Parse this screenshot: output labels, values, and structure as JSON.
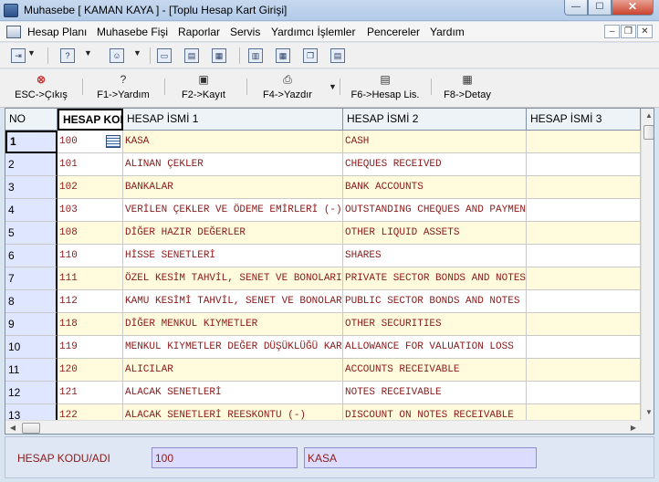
{
  "window": {
    "title": "Muhasebe [ KAMAN KAYA ]  - [Toplu Hesap Kart Girişi]",
    "min_icon": "minimize-icon",
    "max_icon": "maximize-icon",
    "close_icon": "close-icon",
    "min_glyph": "—",
    "max_glyph": "☐",
    "close_glyph": "✕"
  },
  "menu": {
    "items": [
      "Hesap Planı",
      "Muhasebe Fişi",
      "Raporlar",
      "Servis",
      "Yardımcı İşlemler",
      "Pencereler",
      "Yardım"
    ],
    "mdi_min": "–",
    "mdi_restore": "❐",
    "mdi_close": "✕"
  },
  "toolbar_small": {
    "icons": [
      "exit-icon",
      "help-icon",
      "user-icon",
      "window-icon",
      "window-list-icon",
      "table-icon",
      "grid-icon",
      "stack-icon",
      "list-icon"
    ]
  },
  "toolbar": {
    "buttons": [
      {
        "label": "ESC->Çıkış",
        "icon": "cancel-icon",
        "glyph": "⊗"
      },
      {
        "label": "F1->Yardım",
        "icon": "help-icon",
        "glyph": "?"
      },
      {
        "label": "F2->Kayıt",
        "icon": "save-icon",
        "glyph": "▣"
      },
      {
        "label": "F4->Yazdır",
        "icon": "print-icon",
        "glyph": "⎙"
      },
      {
        "label": "F6->Hesap Lis.",
        "icon": "list-icon",
        "glyph": "▤"
      },
      {
        "label": "F8->Detay",
        "icon": "detail-icon",
        "glyph": "▦"
      }
    ],
    "dropdown_glyph": "▼"
  },
  "grid": {
    "columns": [
      "NO",
      "HESAP KODU",
      "HESAP İSMİ 1",
      "HESAP İSMİ 2",
      "HESAP İSMİ 3"
    ],
    "rows": [
      {
        "no": "1",
        "code": "100",
        "name1": "KASA",
        "name2": "CASH",
        "name3": ""
      },
      {
        "no": "2",
        "code": "101",
        "name1": "ALINAN ÇEKLER",
        "name2": "CHEQUES RECEIVED",
        "name3": ""
      },
      {
        "no": "3",
        "code": "102",
        "name1": "BANKALAR",
        "name2": "BANK ACCOUNTS",
        "name3": ""
      },
      {
        "no": "4",
        "code": "103",
        "name1": "VERİLEN ÇEKLER VE ÖDEME EMİRLERİ (-)",
        "name2": "OUTSTANDING CHEQUES AND PAYMENT ORDERS",
        "name3": ""
      },
      {
        "no": "5",
        "code": "108",
        "name1": "DİĞER HAZIR DEĞERLER",
        "name2": "OTHER LIQUID ASSETS",
        "name3": ""
      },
      {
        "no": "6",
        "code": "110",
        "name1": "HİSSE SENETLERİ",
        "name2": "SHARES",
        "name3": ""
      },
      {
        "no": "7",
        "code": "111",
        "name1": "ÖZEL KESİM TAHVİL, SENET VE BONOLARI",
        "name2": "PRIVATE SECTOR BONDS AND NOTES",
        "name3": ""
      },
      {
        "no": "8",
        "code": "112",
        "name1": "KAMU KESİMİ TAHVİL, SENET VE BONOLARI",
        "name2": "PUBLIC SECTOR BONDS AND NOTES",
        "name3": ""
      },
      {
        "no": "9",
        "code": "118",
        "name1": "DİĞER MENKUL KIYMETLER",
        "name2": "OTHER SECURITIES",
        "name3": ""
      },
      {
        "no": "10",
        "code": "119",
        "name1": "MENKUL KIYMETLER DEĞER DÜŞÜKLÜĞÜ KARŞILIĞI",
        "name2": "ALLOWANCE FOR VALUATION LOSS",
        "name3": ""
      },
      {
        "no": "11",
        "code": "120",
        "name1": "ALICILAR",
        "name2": "ACCOUNTS RECEIVABLE",
        "name3": ""
      },
      {
        "no": "12",
        "code": "121",
        "name1": "ALACAK SENETLERİ",
        "name2": "NOTES RECEIVABLE",
        "name3": ""
      },
      {
        "no": "13",
        "code": "122",
        "name1": "ALACAK SENETLERİ REESKONTU (-)",
        "name2": "DISCOUNT ON NOTES RECEIVABLE",
        "name3": ""
      }
    ],
    "selected_row": "1",
    "selected_column": "HESAP KODU",
    "scroll_up": "▲",
    "scroll_down": "▼",
    "scroll_left": "◀",
    "scroll_right": "▶"
  },
  "footer": {
    "label": "HESAP KODU/ADI",
    "code_value": "100",
    "name_value": "KASA"
  }
}
